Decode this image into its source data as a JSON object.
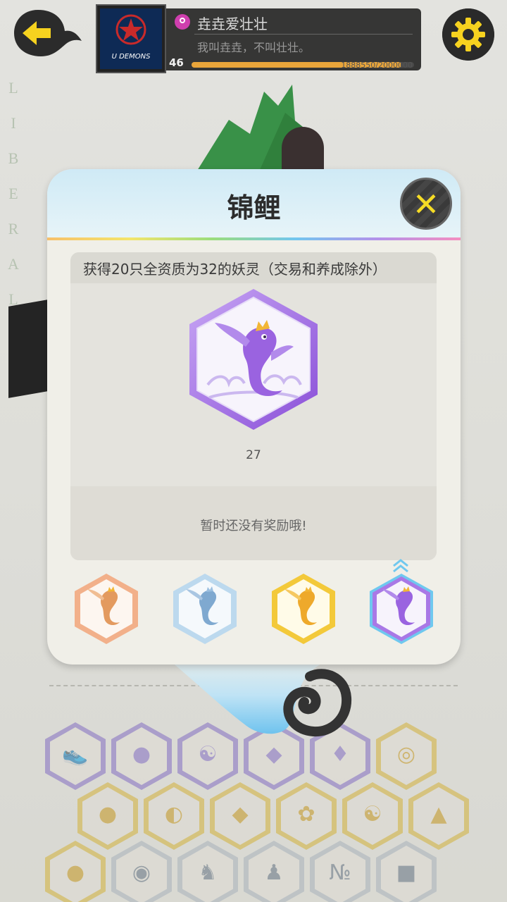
{
  "header": {
    "player_name": "垚垚爱壮壮",
    "signature": "我叫垚垚，不叫壮壮。",
    "level": "46",
    "xp_text": "1888550/2000000",
    "xp_progress": 0.94,
    "avatar_caption": "U DEMONS"
  },
  "scene": {
    "side_letters": [
      "L",
      "I",
      "B",
      "E",
      "R",
      "A",
      "L"
    ]
  },
  "modal": {
    "title": "锦鲤",
    "description": "获得20只全资质为32的妖灵（交易和养成除外）",
    "count": "27",
    "reward_text": "暂时还没有奖励哦!",
    "close_label": "✕"
  },
  "tiers": [
    {
      "name": "bronze",
      "color": "#f2b08a",
      "active": false
    },
    {
      "name": "silver",
      "color": "#a9cfe8",
      "active": false
    },
    {
      "name": "gold",
      "color": "#f3c93a",
      "active": false
    },
    {
      "name": "purple",
      "color": "#a978e6",
      "active": true
    }
  ],
  "colors": {
    "accent_purple": "#9a63e0",
    "close_yellow": "#f6dc25",
    "back_arrow": "#f6d21f"
  },
  "badge_wall_icons": [
    "shoe-icon",
    "owl-icon",
    "yinyang-moon-icon",
    "bear-icon",
    "fish-icon",
    "lollipop-icon",
    "moon-ball-icon",
    "helmet-icon",
    "egg-icon",
    "flame-icon",
    "yinyang-icon",
    "basket-icon",
    "face-icon",
    "shield-icon",
    "cat-icon",
    "ghost-icon",
    "no1-icon",
    "chest-icon"
  ]
}
